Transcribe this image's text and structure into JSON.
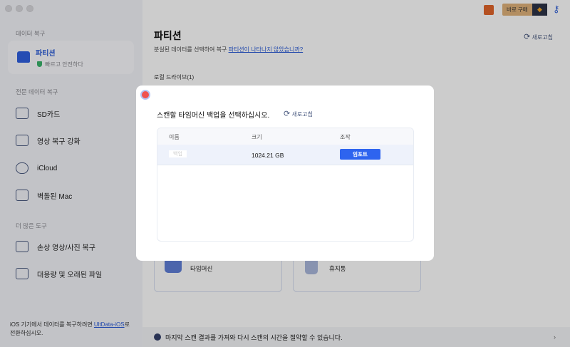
{
  "sidebar": {
    "section1": "데이터 복구",
    "active": {
      "label": "파티션",
      "sub": "빠르고 안전하다"
    },
    "section2": "전문 데이터 복구",
    "items": [
      "SD카드",
      "영상 복구 강화",
      "iCloud",
      "벽돌된 Mac"
    ],
    "section3": "더 많은 도구",
    "tools": [
      "손상 영상/사진 복구",
      "대용량 및 오래된 파일"
    ],
    "footer_text": "iOS 기기에서 데이터를 복구하려면 ",
    "footer_link": "UltData-iOS",
    "footer_tail": "로 전환하십시오."
  },
  "header": {
    "buy_label": "바로 구매"
  },
  "main": {
    "title": "파티션",
    "subtitle": "분실된 데이터를 선택하여 복구 ",
    "subtitle_link": "파티션이 나타나지 않았습니까?",
    "refresh": "새로고침",
    "local_drives": "로컬 드라이브(1)",
    "cards": [
      "타임머신",
      "휴지통"
    ],
    "bottom_bar": "마지막 스캔 결과를 가져와 다시 스캔의 시간을 절약할 수 있습니다."
  },
  "modal": {
    "title": "스캔할 타임머신 백업을 선택하십시오.",
    "refresh": "새로고침",
    "columns": [
      "이름",
      "크기",
      "조작"
    ],
    "rows": [
      {
        "name": "백업",
        "size": "1024.21 GB",
        "action": "임포트"
      }
    ]
  }
}
